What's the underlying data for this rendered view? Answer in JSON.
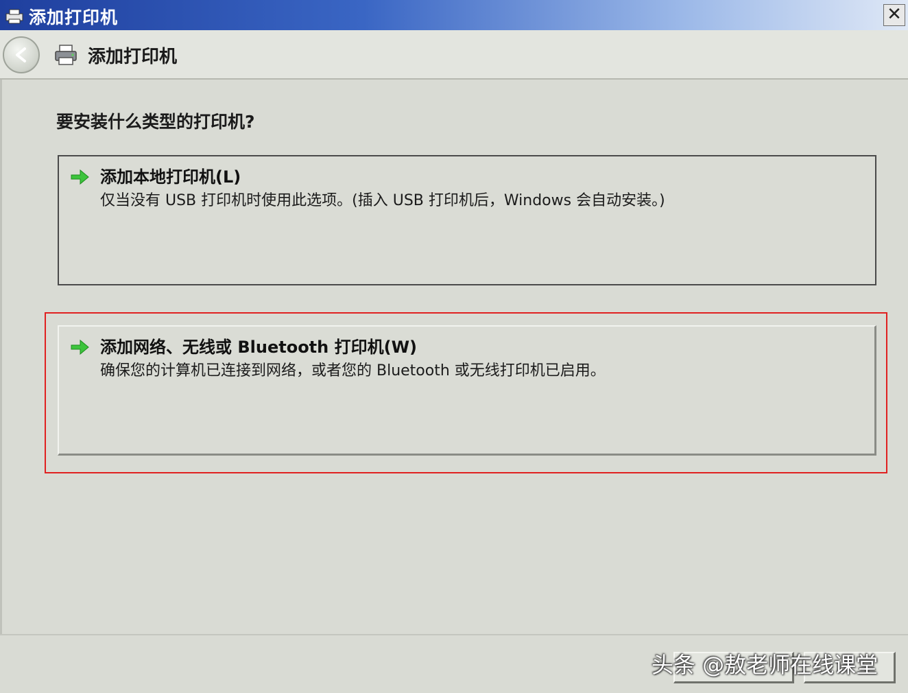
{
  "window": {
    "title": "添加打印机",
    "close_label": "✕"
  },
  "nav": {
    "title": "添加打印机"
  },
  "main": {
    "question": "要安装什么类型的打印机?",
    "options": [
      {
        "title": "添加本地打印机(L)",
        "description": "仅当没有 USB 打印机时使用此选项。(插入 USB 打印机后，Windows 会自动安装。)",
        "icon": "green-arrow-icon"
      },
      {
        "title": "添加网络、无线或 Bluetooth 打印机(W)",
        "description": "确保您的计算机已连接到网络，或者您的 Bluetooth 或无线打印机已启用。",
        "icon": "green-arrow-icon"
      }
    ]
  },
  "watermark": "头条 @敖老师在线课堂",
  "colors": {
    "highlight": "#e02020",
    "arrow": "#3cc43c",
    "titlebar": "#1f3f9e"
  }
}
